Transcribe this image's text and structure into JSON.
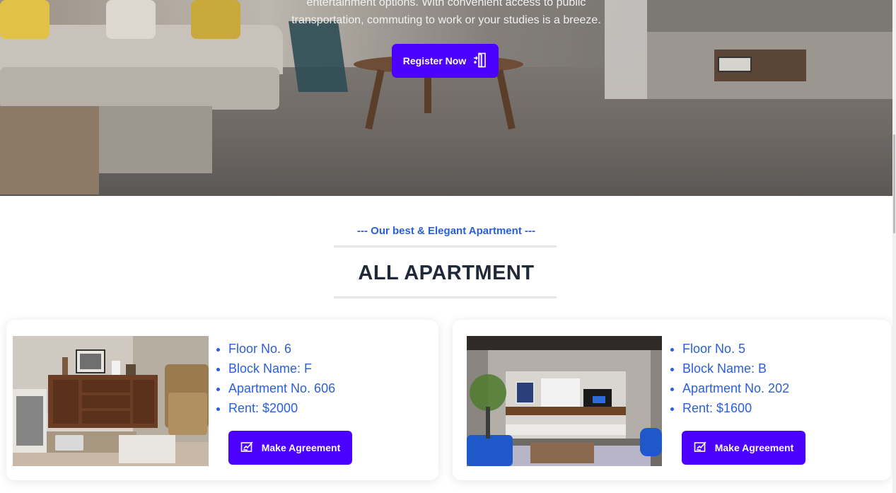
{
  "hero": {
    "text_line1": "entertainment options. With convenient access to public",
    "text_line2": "transportation, commuting to work or your studies is a breeze.",
    "register_label": "Register Now",
    "register_icon": "door-exit-icon"
  },
  "section": {
    "subtitle": "--- Our best & Elegant Apartment ---",
    "title": "ALL APARTMENT"
  },
  "apartments": [
    {
      "floor": "Floor No. 6",
      "block": "Block Name: F",
      "apartment": "Apartment No. 606",
      "rent": "Rent: $2000",
      "button_label": "Make Agreement",
      "button_icon": "signature-icon"
    },
    {
      "floor": "Floor No. 5",
      "block": "Block Name: B",
      "apartment": "Apartment No. 202",
      "rent": "Rent: $1600",
      "button_label": "Make Agreement",
      "button_icon": "signature-icon"
    }
  ],
  "colors": {
    "accent": "#4c00ff",
    "link_blue": "#2b5fd9",
    "heading": "#1f2937"
  }
}
